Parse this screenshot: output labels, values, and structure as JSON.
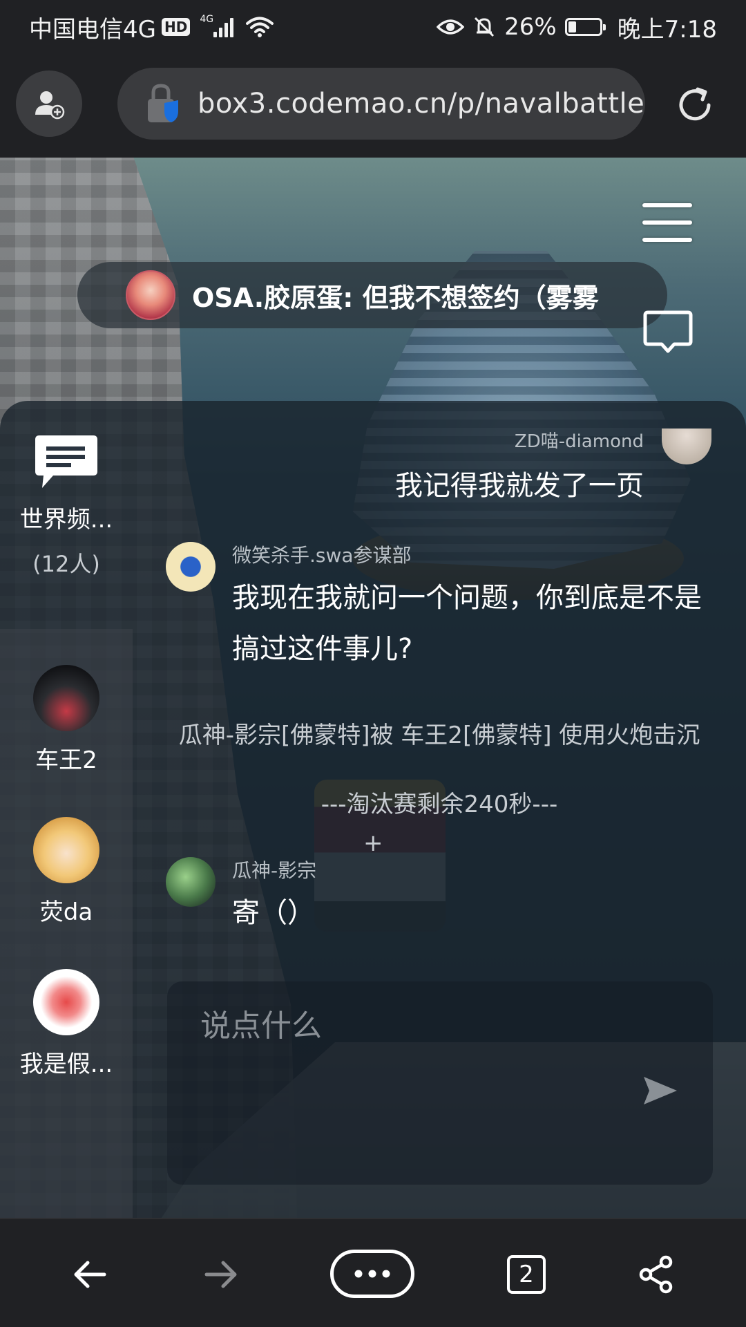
{
  "status_bar": {
    "carrier": "中国电信4G",
    "hd_badge": "HD",
    "signal_tag": "4G",
    "battery": "26%",
    "battery_level": 0.26,
    "time": "晚上7:18"
  },
  "browser": {
    "url": "box3.codemao.cn/p/navalbattle",
    "open_tabs": "2"
  },
  "game": {
    "banner_message": "OSA.胶原蛋: 但我不想签约（雾雾",
    "world_channel": {
      "name": "世界频...",
      "count": "(12人)"
    },
    "channels": [
      {
        "label": "车王2"
      },
      {
        "label": "荧da"
      },
      {
        "label": "我是假..."
      }
    ],
    "messages": {
      "self": {
        "sender": "ZD喵-diamond",
        "text": "我记得我就发了一页"
      },
      "msg1": {
        "sender": "微笑杀手.swa参谋部",
        "text": "我现在我就问一个问题，你到底是不是搞过这件事儿?"
      },
      "msg2": {
        "sender": "瓜神-影宗",
        "text": "寄（）"
      }
    },
    "plus_mark": "+",
    "kill_notice": "瓜神-影宗[佛蒙特]被 车王2[佛蒙特] 使用火炮击沉",
    "timer_notice": "---淘汰赛剩余240秒---",
    "input_placeholder": "说点什么"
  },
  "colors": {
    "browser_chrome": "#202124",
    "url_box": "#3a3b3e",
    "chat_panel": "#18222c"
  }
}
